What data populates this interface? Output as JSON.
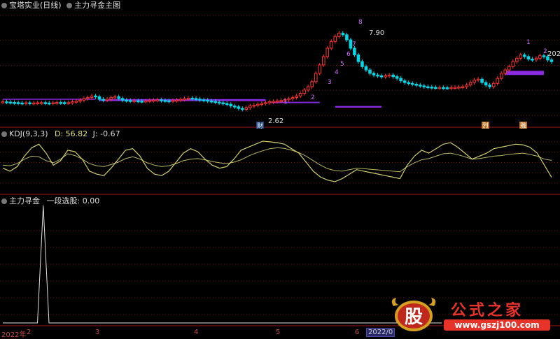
{
  "header_main": {
    "stock": "宝塔实业(日线)",
    "indicator": "主力寻金主图"
  },
  "header_kdj": {
    "name": "KDJ(9,3,3)",
    "d": "D: 56.82",
    "j": "J: -0.67"
  },
  "header_sub": {
    "name": "主力寻金",
    "field": "一段选股: 0.00"
  },
  "price_labels": {
    "high": "7.90",
    "low": "2.62",
    "right": "202"
  },
  "wave_labels": [
    "8",
    "1",
    "2",
    "3",
    "4",
    "5",
    "6",
    "7",
    "1",
    "2"
  ],
  "signal_tags": [
    "财",
    "烈",
    "雅"
  ],
  "x_axis": {
    "ticks": [
      "2022年",
      "2",
      "3",
      "4",
      "5",
      "6"
    ],
    "cursor_date": "2022/0"
  },
  "watermark": {
    "glyph": "股",
    "brand": "公式之家",
    "url": "www.gszj100.com"
  },
  "colors": {
    "up": "#ff3333",
    "down": "#00d8e8",
    "band": "#8a2be2",
    "kdj_line": "#e6e67a",
    "grid": "#7a1010",
    "axis_text": "#c34b4b"
  },
  "chart_data": [
    {
      "type": "candlestick",
      "title": "主力寻金主图",
      "x_ticks": [
        "2022年",
        "2",
        "3",
        "4",
        "5",
        "6"
      ],
      "annotations": [
        {
          "label": "7.90",
          "kind": "high"
        },
        {
          "label": "2.62",
          "kind": "low"
        }
      ],
      "close": [
        3.7,
        3.68,
        3.66,
        3.65,
        3.63,
        3.62,
        3.64,
        3.62,
        3.63,
        3.64,
        3.65,
        3.63,
        3.62,
        3.64,
        3.66,
        3.65,
        3.64,
        3.65,
        3.7,
        3.74,
        3.8,
        3.9,
        3.95,
        4.05,
        4.0,
        3.85,
        3.8,
        3.85,
        3.95,
        4.0,
        3.9,
        3.8,
        3.78,
        3.75,
        3.76,
        3.74,
        3.73,
        3.75,
        3.78,
        3.8,
        3.82,
        3.78,
        3.76,
        3.74,
        3.78,
        3.8,
        3.84,
        3.88,
        3.92,
        3.9,
        3.86,
        3.82,
        3.8,
        3.75,
        3.72,
        3.68,
        3.64,
        3.6,
        3.55,
        3.45,
        3.4,
        3.3,
        3.25,
        3.35,
        3.45,
        3.5,
        3.55,
        3.6,
        3.65,
        3.7,
        3.72,
        3.75,
        3.78,
        3.82,
        3.88,
        3.95,
        4.05,
        4.2,
        4.4,
        4.6,
        4.9,
        5.4,
        5.9,
        6.4,
        6.9,
        7.3,
        7.6,
        7.8,
        7.7,
        7.4,
        6.9,
        6.5,
        6.1,
        5.8,
        5.6,
        5.4,
        5.3,
        5.25,
        5.2,
        5.25,
        5.3,
        5.2,
        5.1,
        4.95,
        4.85,
        4.8,
        4.75,
        4.7,
        4.65,
        4.6,
        4.58,
        4.56,
        4.55,
        4.55,
        4.54,
        4.53,
        4.55,
        4.56,
        4.58,
        4.6,
        4.7,
        4.85,
        5.0,
        5.05,
        4.85,
        4.7,
        4.6,
        4.8,
        5.1,
        5.4,
        5.6,
        5.8,
        6.1,
        6.3,
        6.5,
        6.4,
        6.25,
        6.2,
        6.3,
        6.45,
        6.4,
        6.2,
        6.1
      ],
      "xlim_bars": 145
    },
    {
      "type": "line",
      "title": "KDJ(9,3,3)",
      "series": [
        {
          "name": "D",
          "values": [
            40,
            38,
            45,
            60,
            70,
            68,
            55,
            48,
            60,
            78,
            72,
            60,
            45,
            38,
            35,
            42,
            50,
            62,
            68,
            60,
            48,
            40,
            35,
            38,
            45,
            55,
            60,
            62,
            58,
            52,
            48,
            45,
            50,
            58,
            70,
            80,
            88,
            95,
            98,
            96,
            90,
            82,
            70,
            55,
            40,
            28,
            22,
            20,
            25,
            30,
            28,
            26,
            24,
            22,
            20,
            18,
            35,
            48,
            58,
            62,
            70,
            78,
            80,
            75,
            68,
            60,
            62,
            66,
            70,
            72,
            76,
            78,
            80,
            76,
            70,
            60,
            56
          ]
        },
        {
          "name": "J",
          "values": [
            30,
            20,
            35,
            70,
            98,
            110,
            80,
            40,
            55,
            90,
            85,
            60,
            20,
            10,
            5,
            30,
            60,
            90,
            95,
            70,
            30,
            10,
            5,
            20,
            50,
            80,
            95,
            85,
            60,
            40,
            30,
            35,
            60,
            90,
            100,
            110,
            120,
            118,
            115,
            110,
            95,
            80,
            50,
            20,
            0,
            -10,
            -15,
            -5,
            10,
            25,
            20,
            15,
            10,
            5,
            0,
            -5,
            40,
            70,
            90,
            80,
            95,
            110,
            115,
            100,
            80,
            60,
            70,
            80,
            95,
            100,
            105,
            110,
            108,
            100,
            80,
            40,
            -0.67
          ]
        }
      ]
    },
    {
      "type": "line",
      "title": "主力寻金",
      "series": [
        {
          "name": "一段选股",
          "values": [
            0,
            0,
            0,
            0,
            0,
            0,
            0,
            1,
            0,
            0,
            0,
            0,
            0,
            0,
            0,
            0,
            0,
            0,
            0,
            0,
            0,
            0,
            0,
            0,
            0,
            0,
            0,
            0,
            0,
            0,
            0,
            0,
            0,
            0,
            0,
            0,
            0,
            0,
            0,
            0,
            0,
            0,
            0,
            0,
            0,
            0,
            0,
            0,
            0,
            0,
            0,
            0,
            0,
            0,
            0,
            0,
            0,
            0,
            0,
            0,
            0,
            0,
            0,
            0,
            0,
            0,
            0,
            0,
            0,
            0,
            0,
            0,
            0,
            0,
            0,
            0,
            0
          ]
        }
      ],
      "ylim": [
        0,
        1
      ]
    }
  ]
}
